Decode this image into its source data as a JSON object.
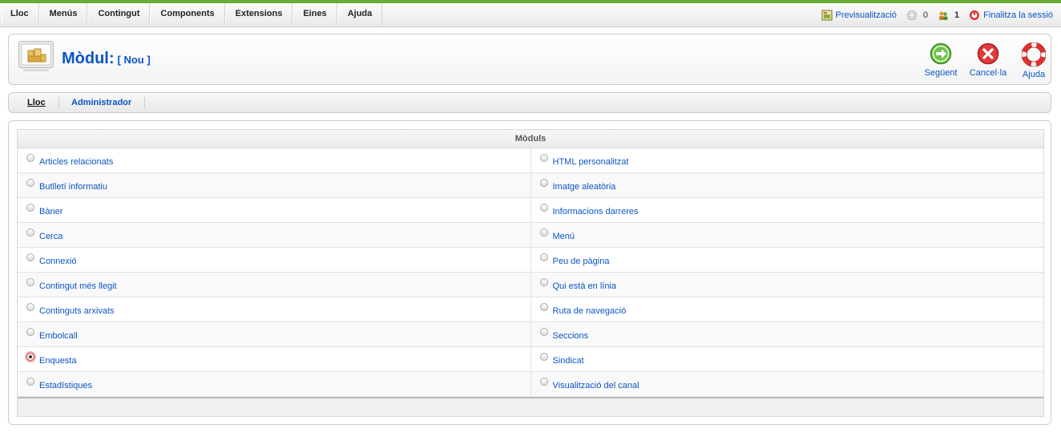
{
  "menu": [
    "Lloc",
    "Menús",
    "Contingut",
    "Components",
    "Extensions",
    "Eines",
    "Ajuda"
  ],
  "status": {
    "preview": "Previsualització",
    "messages": "0",
    "users": "1",
    "logout": "Finalitza la sessió"
  },
  "header": {
    "title": "Mòdul:",
    "subtitle": "[ Nou ]"
  },
  "toolbar": {
    "next": "Següent",
    "cancel": "Cancel·la",
    "help": "Ajuda"
  },
  "submenu": [
    "Lloc",
    "Administrador"
  ],
  "table": {
    "header": "Mòduls",
    "selected": "Enquesta",
    "left": [
      "Articles relacionats",
      "Butlletí informatiu",
      "Bàner",
      "Cerca",
      "Connexió",
      "Contingut més llegit",
      "Continguts arxivats",
      "Embolcall",
      "Enquesta",
      "Estadístiques"
    ],
    "right": [
      "HTML personalitzat",
      "Imatge aleatòria",
      "Informacions darreres",
      "Menú",
      "Peu de pàgina",
      "Qui està en línia",
      "Ruta de navegació",
      "Seccions",
      "Sindicat",
      "Visualització del canal"
    ]
  },
  "colors": {
    "link": "#0b55c4",
    "accent": "#6aab3a"
  }
}
